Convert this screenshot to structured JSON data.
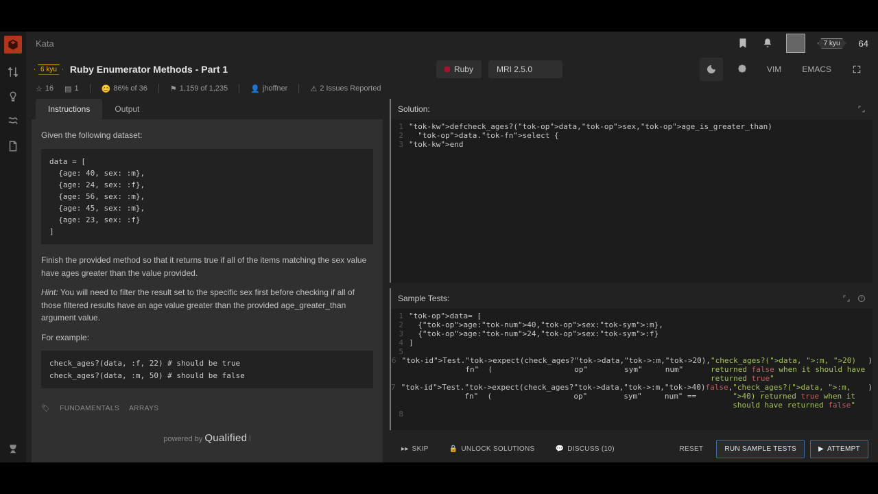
{
  "top": {
    "crumb": "Kata",
    "user_kyu": "7 kyu",
    "points": "64"
  },
  "kata": {
    "kyu": "6 kyu",
    "title": "Ruby Enumerator Methods - Part 1",
    "stars": "16",
    "collected": "1",
    "satisfaction": "86% of 36",
    "completed": "1,159 of 1,235",
    "author": "jhoffner",
    "issues": "2 Issues Reported"
  },
  "tabs": {
    "instructions": "Instructions",
    "output": "Output"
  },
  "instructions": {
    "p1": "Given the following dataset:",
    "code1": "data = [\n  {age: 40, sex: :m},\n  {age: 24, sex: :f},\n  {age: 56, sex: :m},\n  {age: 45, sex: :m},\n  {age: 23, sex: :f}\n]",
    "p2": "Finish the provided method so that it returns true if all of the items matching the sex value have ages greater than the value provided.",
    "hint_label": "Hint:",
    "p3": "You will need to filter the result set to the specific sex first before checking if all of those filtered results have an age value greater than the provided age_greater_than argument value.",
    "p4": "For example:",
    "code2": "check_ages?(data, :f, 22) # should be true\ncheck_ages?(data, :m, 50) # should be false",
    "tag1": "FUNDAMENTALS",
    "tag2": "ARRAYS",
    "powered_pre": "powered by ",
    "powered": "Qualified"
  },
  "toolbar": {
    "lang": "Ruby",
    "version": "MRI 2.5.0",
    "vim": "VIM",
    "emacs": "EMACS"
  },
  "solution": {
    "label": "Solution:",
    "lines": [
      "def check_ages?(data, sex, age_is_greater_than)",
      "  data.select {",
      "end"
    ]
  },
  "tests": {
    "label": "Sample Tests:",
    "lines": [
      "data = [",
      "  {age: 40, sex: :m},",
      "  {age: 24, sex: :f}",
      "]",
      "",
      "Test.expect(check_ages?(data, :m, 20), \"check_ages?(data, :m, 20) returned false when it should have returned true\")",
      "Test.expect(check_ages?(data, :m, 40) == false, \"check_ages?(data, :m, 40) returned true when it should have returned false\")",
      ""
    ]
  },
  "actions": {
    "skip": "SKIP",
    "unlock": "UNLOCK SOLUTIONS",
    "discuss": "DISCUSS (10)",
    "reset": "RESET",
    "run": "RUN SAMPLE TESTS",
    "attempt": "ATTEMPT"
  }
}
